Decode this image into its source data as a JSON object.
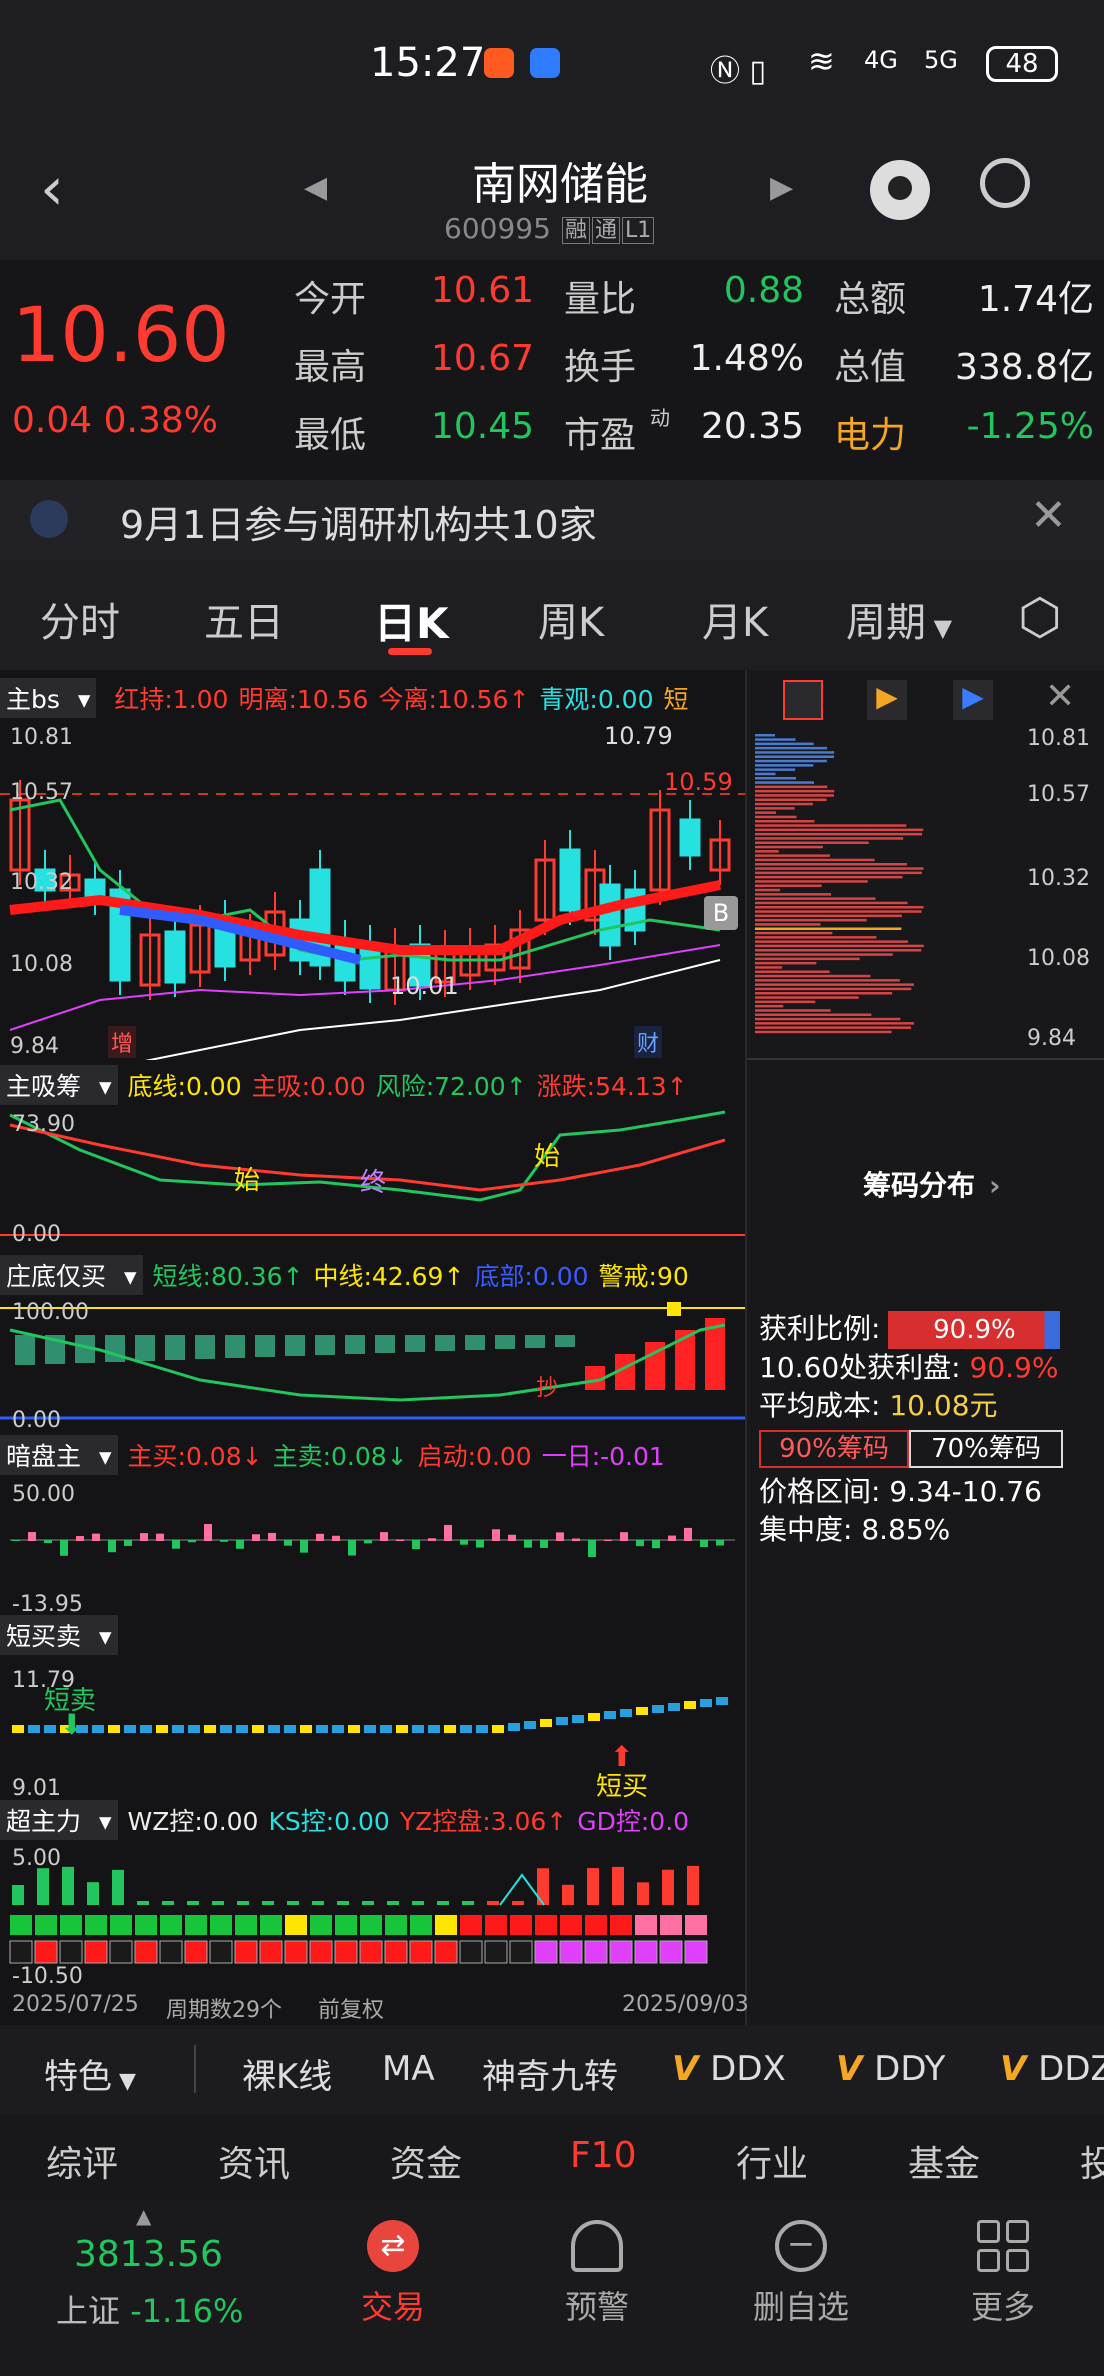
{
  "status": {
    "time": "15:27",
    "battery": "48",
    "net1": "4G",
    "net2": "5G"
  },
  "header": {
    "title": "南网储能",
    "code": "600995",
    "tags": [
      "融",
      "通",
      "L1"
    ]
  },
  "quote": {
    "price": "10.60",
    "change": "0.04",
    "pct": "0.38%",
    "rows": [
      [
        {
          "k": "今开",
          "v": "10.61",
          "c": "red"
        },
        {
          "k": "量比",
          "v": "0.88",
          "c": "green"
        },
        {
          "k": "总额",
          "v": "1.74亿",
          "c": "white"
        }
      ],
      [
        {
          "k": "最高",
          "v": "10.67",
          "c": "red"
        },
        {
          "k": "换手",
          "v": "1.48%",
          "c": "white"
        },
        {
          "k": "总值",
          "v": "338.8亿",
          "c": "white"
        }
      ],
      [
        {
          "k": "最低",
          "v": "10.45",
          "c": "green"
        },
        {
          "k": "市盈",
          "sup": "动",
          "v": "20.35",
          "c": "white"
        },
        {
          "k": "电力",
          "v": "-1.25%",
          "c": "green",
          "korange": true
        }
      ]
    ]
  },
  "notice": {
    "text": "9月1日参与调研机构共10家"
  },
  "tabs": [
    "分时",
    "五日",
    "日K",
    "周K",
    "月K",
    "周期"
  ],
  "main": {
    "selector": "主bs",
    "items": [
      {
        "t": "红持:1.00",
        "c": "red"
      },
      {
        "t": "明离:10.56",
        "c": "red"
      },
      {
        "t": "今离:10.56↑",
        "c": "red"
      },
      {
        "t": "青观:0.00",
        "c": "cyan"
      },
      {
        "t": "短",
        "c": "orange"
      }
    ],
    "y_labels": [
      "10.81",
      "10.57",
      "10.32",
      "10.08",
      "9.84"
    ],
    "high_mark": "10.79",
    "last_mark": "10.59",
    "low_mark": "10.01",
    "b_badge": "B",
    "tag1": "增",
    "tag2": "财"
  },
  "chip": {
    "y_labels": [
      "10.81",
      "10.57",
      "10.32",
      "10.08",
      "9.84"
    ],
    "link": "筹码分布",
    "profit_label": "获利比例:",
    "profit": "90.9%",
    "at_label": "10.60处获利盘:",
    "at_val": "90.9%",
    "avg_label": "平均成本:",
    "avg": "10.08元",
    "btn90": "90%筹码",
    "btn70": "70%筹码",
    "range": "价格区间: 9.34-10.76",
    "conc": "集中度: 8.85%"
  },
  "ind1": {
    "selector": "主吸筹",
    "items": [
      {
        "t": "底线:0.00",
        "c": "yellow"
      },
      {
        "t": "主吸:0.00",
        "c": "red"
      },
      {
        "t": "风险:72.00↑",
        "c": "green"
      },
      {
        "t": "涨跌:54.13↑",
        "c": "red"
      }
    ],
    "ymax": "73.90",
    "ymin": "0.00",
    "m1": "始",
    "m2": "终",
    "m3": "始"
  },
  "ind2": {
    "selector": "庄底仅买",
    "items": [
      {
        "t": "短线:80.36↑",
        "c": "green"
      },
      {
        "t": "中线:42.69↑",
        "c": "yellow"
      },
      {
        "t": "底部:0.00",
        "c": "blue"
      },
      {
        "t": "警戒:90",
        "c": "yellow"
      }
    ],
    "ymax": "100.00",
    "ymin": "0.00",
    "m": "抄"
  },
  "ind3": {
    "selector": "暗盘主",
    "items": [
      {
        "t": "主买:0.08↓",
        "c": "red"
      },
      {
        "t": "主卖:0.08↓",
        "c": "green"
      },
      {
        "t": "启动:0.00",
        "c": "red"
      },
      {
        "t": "一日:-0.01",
        "c": "magenta"
      }
    ],
    "ymax": "50.00",
    "ymin": "-13.95"
  },
  "ind4": {
    "selector": "短买卖",
    "ymax": "11.79",
    "ymin": "9.01",
    "sell": "短卖",
    "buy": "短买"
  },
  "ind5": {
    "selector": "超主力",
    "items": [
      {
        "t": "WZ控:0.00",
        "c": "white"
      },
      {
        "t": "KS控:0.00",
        "c": "cyan"
      },
      {
        "t": "YZ控盘:3.06↑",
        "c": "red"
      },
      {
        "t": "GD控:0.0",
        "c": "magenta"
      }
    ],
    "ymax": "5.00",
    "ymin": "-10.50"
  },
  "axis": {
    "start": "2025/07/25",
    "count": "周期数29个",
    "adj": "前复权",
    "end": "2025/09/03"
  },
  "footer_tabs": {
    "feature": "特色",
    "items": [
      "裸K线",
      "MA",
      "神奇九转",
      "DDX",
      "DDY",
      "DDZ"
    ]
  },
  "news_tabs": [
    "综评",
    "资讯",
    "资金",
    "F10",
    "行业",
    "基金",
    "投"
  ],
  "bottom": {
    "index_val": "3813.56",
    "index_name": "上证",
    "index_pct": "-1.16%",
    "items": [
      "交易",
      "预警",
      "删自选",
      "更多"
    ]
  },
  "colors": {
    "up": "#ff3b30",
    "down": "#22c55e",
    "accent": "#ff3b30",
    "bg": "#141416"
  }
}
